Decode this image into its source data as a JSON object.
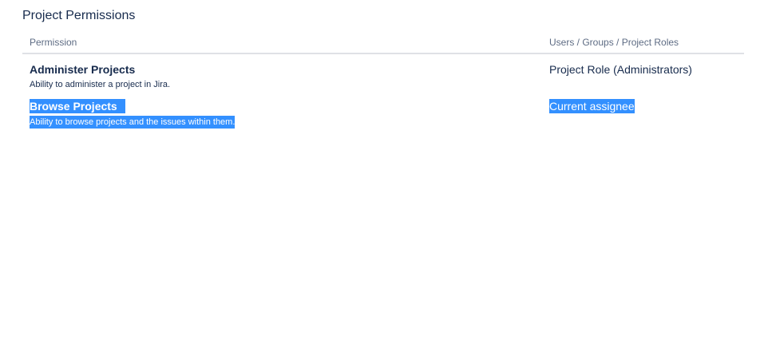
{
  "section": {
    "title": "Project Permissions"
  },
  "table": {
    "headers": {
      "permission": "Permission",
      "users": "Users / Groups / Project Roles"
    },
    "rows": [
      {
        "name": "Administer Projects",
        "description": "Ability to administer a project in Jira.",
        "users": "Project Role (Administrators)",
        "selected": false
      },
      {
        "name": "Browse Projects",
        "description": "Ability to browse projects and the issues within them.",
        "users": "Current assignee",
        "selected": true
      }
    ]
  },
  "colors": {
    "selection": "#3390ff",
    "text": "#172b4d",
    "header_text": "#5e6c84",
    "divider": "#dfe1e6"
  }
}
